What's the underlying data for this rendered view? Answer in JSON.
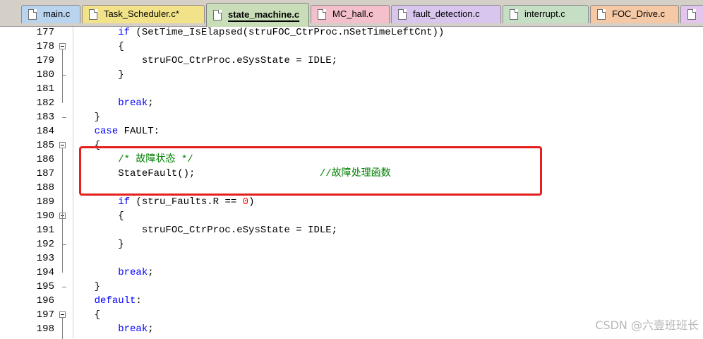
{
  "tabs": [
    {
      "label": "main.c",
      "color": "#b9d4ee"
    },
    {
      "label": "Task_Scheduler.c*",
      "color": "#f2e38a"
    },
    {
      "label": "state_machine.c",
      "color": "#c9ddb8",
      "active": true
    },
    {
      "label": "MC_hall.c",
      "color": "#f4c0cc"
    },
    {
      "label": "fault_detection.c",
      "color": "#d9c6ee"
    },
    {
      "label": "interrupt.c",
      "color": "#c5dfc4"
    },
    {
      "label": "FOC_Drive.c",
      "color": "#f5c9a6"
    },
    {
      "label": "",
      "color": "#e2c6ee"
    }
  ],
  "lines": [
    {
      "num": "177",
      "code": [
        [
          "        ",
          ""
        ],
        [
          "if",
          "kw"
        ],
        [
          " (SetTime_IsElapsed(struFOC_CtrProc.nSetTimeLeftCnt))",
          ""
        ]
      ]
    },
    {
      "num": "178",
      "fold": true,
      "code": [
        [
          "        {",
          ""
        ]
      ]
    },
    {
      "num": "179",
      "code": [
        [
          "            struFOC_CtrProc.eSysState = IDLE;",
          ""
        ]
      ]
    },
    {
      "num": "180",
      "code": [
        [
          "        }",
          ""
        ]
      ]
    },
    {
      "num": "181",
      "code": [
        [
          "",
          ""
        ]
      ]
    },
    {
      "num": "182",
      "code": [
        [
          "        ",
          ""
        ],
        [
          "break",
          "kw"
        ],
        [
          ";",
          ""
        ]
      ]
    },
    {
      "num": "183",
      "code": [
        [
          "    }",
          ""
        ]
      ]
    },
    {
      "num": "184",
      "code": [
        [
          "    ",
          ""
        ],
        [
          "case",
          "kw"
        ],
        [
          " FAULT:",
          ""
        ]
      ]
    },
    {
      "num": "185",
      "fold": true,
      "code": [
        [
          "    {",
          ""
        ]
      ]
    },
    {
      "num": "186",
      "code": [
        [
          "        ",
          ""
        ],
        [
          "/* 故障状态 */",
          "cm"
        ]
      ]
    },
    {
      "num": "187",
      "code": [
        [
          "        StateFault();                     ",
          ""
        ],
        [
          "//故障处理函数",
          "cm"
        ]
      ]
    },
    {
      "num": "188",
      "code": [
        [
          "",
          ""
        ]
      ]
    },
    {
      "num": "189",
      "code": [
        [
          "        ",
          ""
        ],
        [
          "if",
          "kw"
        ],
        [
          " (stru_Faults.R == ",
          ""
        ],
        [
          "0",
          "num"
        ],
        [
          ")",
          ""
        ]
      ]
    },
    {
      "num": "190",
      "fold": true,
      "code": [
        [
          "        {",
          ""
        ]
      ]
    },
    {
      "num": "191",
      "code": [
        [
          "            struFOC_CtrProc.eSysState = IDLE;",
          ""
        ]
      ]
    },
    {
      "num": "192",
      "code": [
        [
          "        }",
          ""
        ]
      ]
    },
    {
      "num": "193",
      "code": [
        [
          "",
          ""
        ]
      ]
    },
    {
      "num": "194",
      "code": [
        [
          "        ",
          ""
        ],
        [
          "break",
          "kw"
        ],
        [
          ";",
          ""
        ]
      ]
    },
    {
      "num": "195",
      "code": [
        [
          "    }",
          ""
        ]
      ]
    },
    {
      "num": "196",
      "code": [
        [
          "    ",
          ""
        ],
        [
          "default",
          "kw"
        ],
        [
          ":",
          ""
        ]
      ]
    },
    {
      "num": "197",
      "fold": true,
      "code": [
        [
          "    {",
          ""
        ]
      ]
    },
    {
      "num": "198",
      "code": [
        [
          "        ",
          ""
        ],
        [
          "break",
          "kw"
        ],
        [
          ";",
          ""
        ]
      ]
    }
  ],
  "watermark": "CSDN @六壹班班长"
}
